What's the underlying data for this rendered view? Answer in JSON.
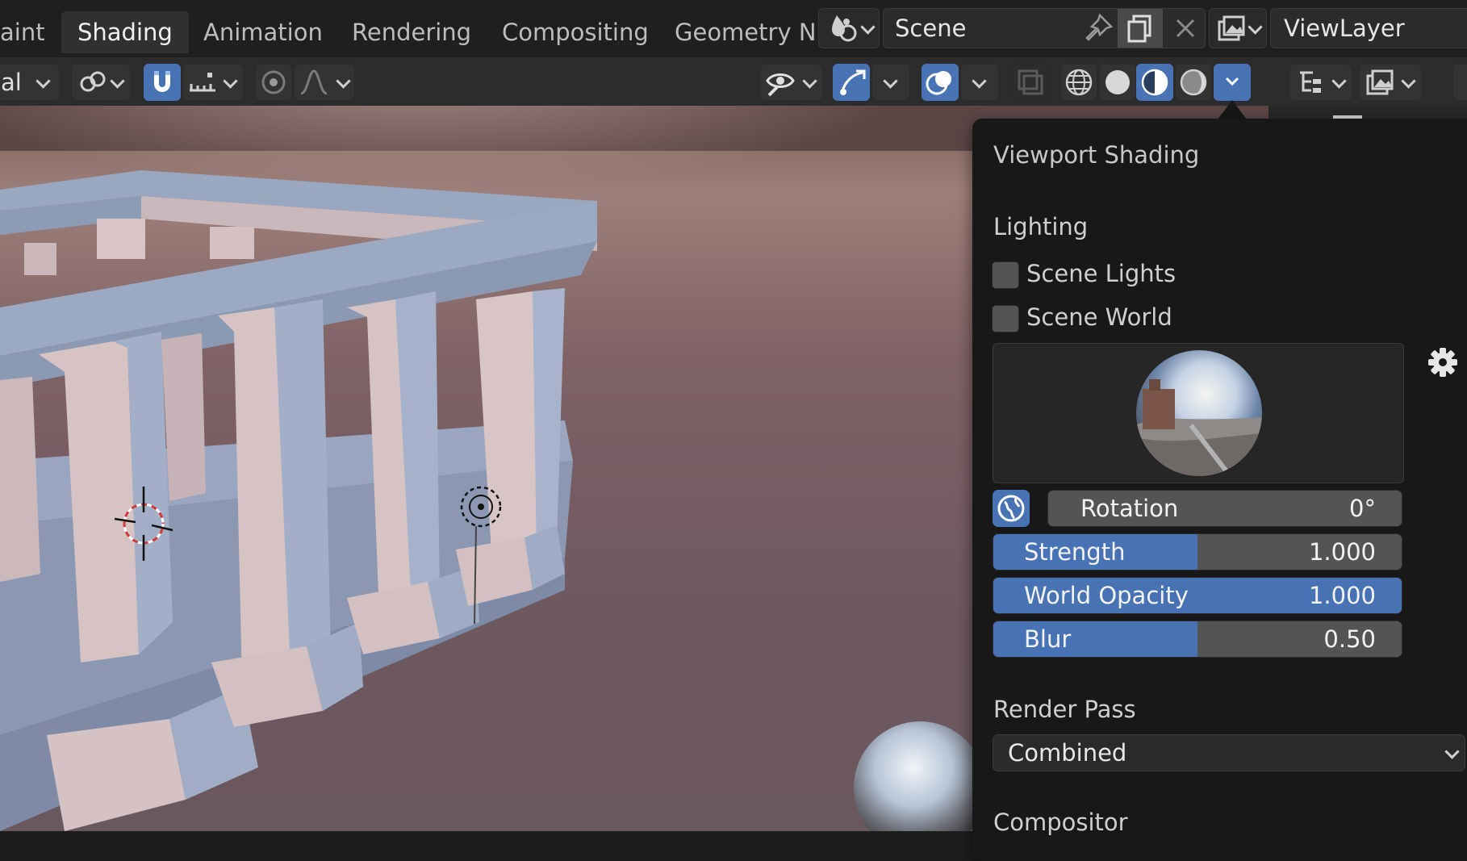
{
  "workspace_tabs": [
    {
      "label": "aint",
      "active": false
    },
    {
      "label": "Shading",
      "active": true
    },
    {
      "label": "Animation",
      "active": false
    },
    {
      "label": "Rendering",
      "active": false
    },
    {
      "label": "Compositing",
      "active": false
    },
    {
      "label": "Geometry N",
      "active": false
    }
  ],
  "scene": {
    "label": "Scene",
    "icons": [
      "scene-data-icon",
      "pin-icon",
      "new-scene-icon",
      "close-icon"
    ]
  },
  "view_layer": {
    "label": "ViewLayer",
    "icon": "view-layer-icon"
  },
  "viewport_header": {
    "transform_orientation": "al",
    "icons": [
      "pivot-icon",
      "snap-magnet-icon",
      "snap-increment-icon",
      "proportional-edit-icon",
      "falloff-curve-icon",
      "visibility-eye-icon",
      "gizmo-icon",
      "overlay-icon",
      "xray-icon",
      "wireframe-shading-icon",
      "solid-shading-icon",
      "material-preview-shading-icon",
      "rendered-shading-icon",
      "shading-options-icon"
    ],
    "active_shading_mode": "material-preview"
  },
  "outliner_header": {
    "icons": [
      "display-mode-icon",
      "filter-icon"
    ]
  },
  "shading_panel": {
    "title": "Viewport Shading",
    "lighting_heading": "Lighting",
    "scene_lights": {
      "label": "Scene Lights",
      "checked": false
    },
    "scene_world": {
      "label": "Scene World",
      "checked": false
    },
    "hdri_preview": {
      "icon": "hdri-sphere-preview"
    },
    "settings_icon": "gear-icon",
    "world_space_lighting_icon": "world-space-lighting-icon",
    "rotation": {
      "label": "Rotation",
      "value": "0°"
    },
    "strength": {
      "label": "Strength",
      "value": "1.000",
      "level": 0.5
    },
    "world_opacity": {
      "label": "World Opacity",
      "value": "1.000",
      "level": 1.0
    },
    "blur": {
      "label": "Blur",
      "value": "0.50",
      "level": 0.5
    },
    "render_pass_heading": "Render Pass",
    "render_pass_value": "Combined",
    "compositor_heading": "Compositor"
  },
  "colors": {
    "accent_blue": "#4772b3",
    "panel_bg": "#181818",
    "header_bg": "#2c2c2c",
    "slider_bg": "#545454"
  }
}
